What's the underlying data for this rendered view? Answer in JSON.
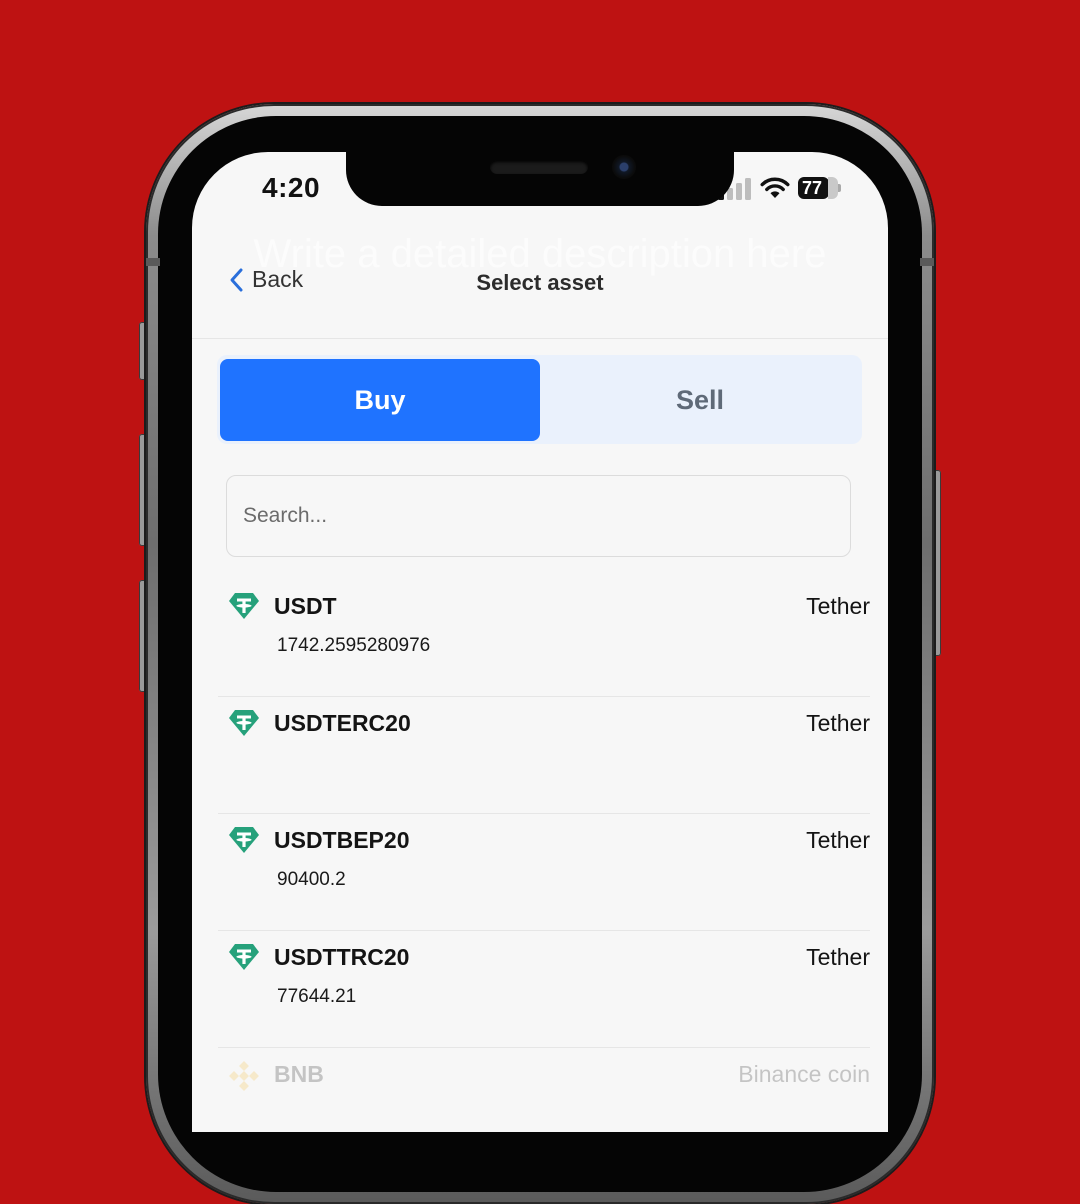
{
  "status_bar": {
    "time": "4:20",
    "battery": "77",
    "battery_percent": 77
  },
  "watermark": "Write a detailed description here",
  "header": {
    "back_label": "Back",
    "title": "Select asset"
  },
  "tabs": [
    {
      "label": "Buy",
      "selected": true
    },
    {
      "label": "Sell",
      "selected": false
    }
  ],
  "search": {
    "placeholder": "Search...",
    "value": ""
  },
  "assets": [
    {
      "symbol": "USDT",
      "name": "Tether",
      "balance": "1742.2595280976",
      "icon": "tether-icon"
    },
    {
      "symbol": "USDTERC20",
      "name": "Tether",
      "balance": "",
      "icon": "tether-icon"
    },
    {
      "symbol": "USDTBEP20",
      "name": "Tether",
      "balance": "90400.2",
      "icon": "tether-icon"
    },
    {
      "symbol": "USDTTRC20",
      "name": "Tether",
      "balance": "77644.21",
      "icon": "tether-icon"
    },
    {
      "symbol": "BNB",
      "name": "Binance coin",
      "balance": "",
      "icon": "binance-icon"
    }
  ],
  "colors": {
    "background": "#be1212",
    "accent": "#1f73ff",
    "tether": "#26a17b",
    "binance": "#f3ba2f"
  }
}
